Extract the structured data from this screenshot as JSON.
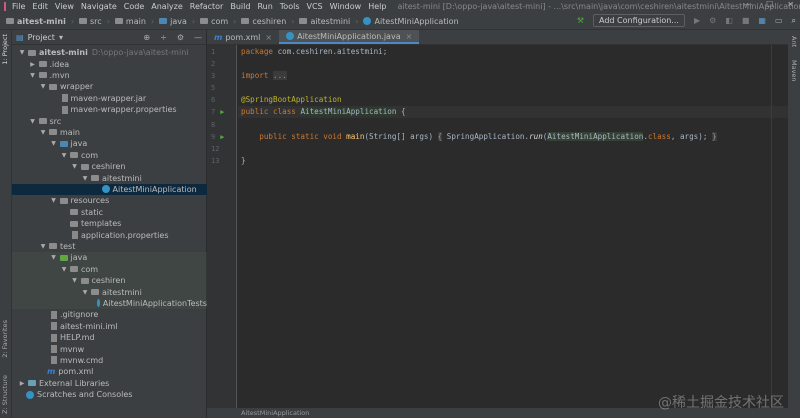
{
  "menu": {
    "items": [
      "File",
      "Edit",
      "View",
      "Navigate",
      "Code",
      "Analyze",
      "Refactor",
      "Build",
      "Run",
      "Tools",
      "VCS",
      "Window",
      "Help"
    ],
    "window_title": "aitest-mini [D:\\oppo-java\\aitest-mini] - ...\\src\\main\\java\\com\\ceshiren\\aitestmini\\AitestMiniApplication.java"
  },
  "breadcrumb": [
    "aitest-mini",
    "src",
    "main",
    "java",
    "com",
    "ceshiren",
    "aitestmini",
    "AitestMiniApplication"
  ],
  "toolbar": {
    "add_configuration": "Add Configuration..."
  },
  "side_tabs": {
    "project": "1: Project",
    "favorites": "2: Favorites",
    "structure": "Z: Structure",
    "ant": "Ant",
    "maven": "Maven"
  },
  "project": {
    "title": "Project",
    "tree": [
      {
        "label": "aitest-mini",
        "path": "D:\\oppo-java\\aitest-mini",
        "depth": 0,
        "arrow": "down",
        "kind": "module"
      },
      {
        "label": ".idea",
        "depth": 1,
        "arrow": "right",
        "kind": "folder"
      },
      {
        "label": ".mvn",
        "depth": 1,
        "arrow": "down",
        "kind": "folder"
      },
      {
        "label": "wrapper",
        "depth": 2,
        "arrow": "down",
        "kind": "folder"
      },
      {
        "label": "maven-wrapper.jar",
        "depth": 3,
        "kind": "file"
      },
      {
        "label": "maven-wrapper.properties",
        "depth": 3,
        "kind": "file"
      },
      {
        "label": "src",
        "depth": 1,
        "arrow": "down",
        "kind": "folder"
      },
      {
        "label": "main",
        "depth": 2,
        "arrow": "down",
        "kind": "folder"
      },
      {
        "label": "java",
        "depth": 3,
        "arrow": "down",
        "kind": "src"
      },
      {
        "label": "com",
        "depth": 4,
        "arrow": "down",
        "kind": "folder"
      },
      {
        "label": "ceshiren",
        "depth": 5,
        "arrow": "down",
        "kind": "folder"
      },
      {
        "label": "aitestmini",
        "depth": 6,
        "arrow": "down",
        "kind": "folder"
      },
      {
        "label": "AitestMiniApplication",
        "depth": 7,
        "kind": "class",
        "selected": true
      },
      {
        "label": "resources",
        "depth": 3,
        "arrow": "down",
        "kind": "folder"
      },
      {
        "label": "static",
        "depth": 4,
        "kind": "folder"
      },
      {
        "label": "templates",
        "depth": 4,
        "kind": "folder"
      },
      {
        "label": "application.properties",
        "depth": 4,
        "kind": "file"
      },
      {
        "label": "test",
        "depth": 2,
        "arrow": "down",
        "kind": "folder"
      },
      {
        "label": "java",
        "depth": 3,
        "arrow": "down",
        "kind": "test",
        "test": true
      },
      {
        "label": "com",
        "depth": 4,
        "arrow": "down",
        "kind": "folder",
        "test": true
      },
      {
        "label": "ceshiren",
        "depth": 5,
        "arrow": "down",
        "kind": "folder",
        "test": true
      },
      {
        "label": "aitestmini",
        "depth": 6,
        "arrow": "down",
        "kind": "folder",
        "test": true
      },
      {
        "label": "AitestMiniApplicationTests",
        "depth": 7,
        "kind": "class",
        "test": true
      },
      {
        "label": ".gitignore",
        "depth": 2,
        "kind": "file"
      },
      {
        "label": "aitest-mini.iml",
        "depth": 2,
        "kind": "file"
      },
      {
        "label": "HELP.md",
        "depth": 2,
        "kind": "file"
      },
      {
        "label": "mvnw",
        "depth": 2,
        "kind": "file"
      },
      {
        "label": "mvnw.cmd",
        "depth": 2,
        "kind": "file"
      },
      {
        "label": "pom.xml",
        "depth": 2,
        "kind": "maven"
      },
      {
        "label": "External Libraries",
        "depth": 0,
        "arrow": "right",
        "kind": "lib"
      },
      {
        "label": "Scratches and Consoles",
        "depth": 0,
        "kind": "scratch"
      }
    ]
  },
  "tabs": [
    {
      "label": "pom.xml",
      "active": false
    },
    {
      "label": "AitestMiniApplication.java",
      "active": true
    }
  ],
  "editor": {
    "line_numbers": [
      "1",
      "2",
      "3",
      "5",
      "6",
      "7",
      "8",
      "9",
      "12",
      "13"
    ],
    "code": {
      "l1_kw": "package",
      "l1_rest": " com.ceshiren.aitestmini;",
      "l3_kw": "import",
      "l3_fold": "...",
      "l6": "@SpringBootApplication",
      "l7_kw": "public class ",
      "l7_name": "AitestMiniApplication",
      "l7_rest": " {",
      "l9_kw": "    public static void ",
      "l9_method": "main",
      "l9_a": "(String[] args) ",
      "l9_f1": "{",
      "l9_b": " SpringApplication.",
      "l9_run": "run",
      "l9_c": "(",
      "l9_cls": "AitestMiniApplication",
      "l9_d": ".",
      "l9_kw2": "class",
      "l9_e": ", args); ",
      "l9_f2": "}",
      "l13": "}"
    }
  },
  "status": {
    "breadcrumb": "AitestMiniApplication"
  },
  "watermark": "@稀土掘金技术社区"
}
